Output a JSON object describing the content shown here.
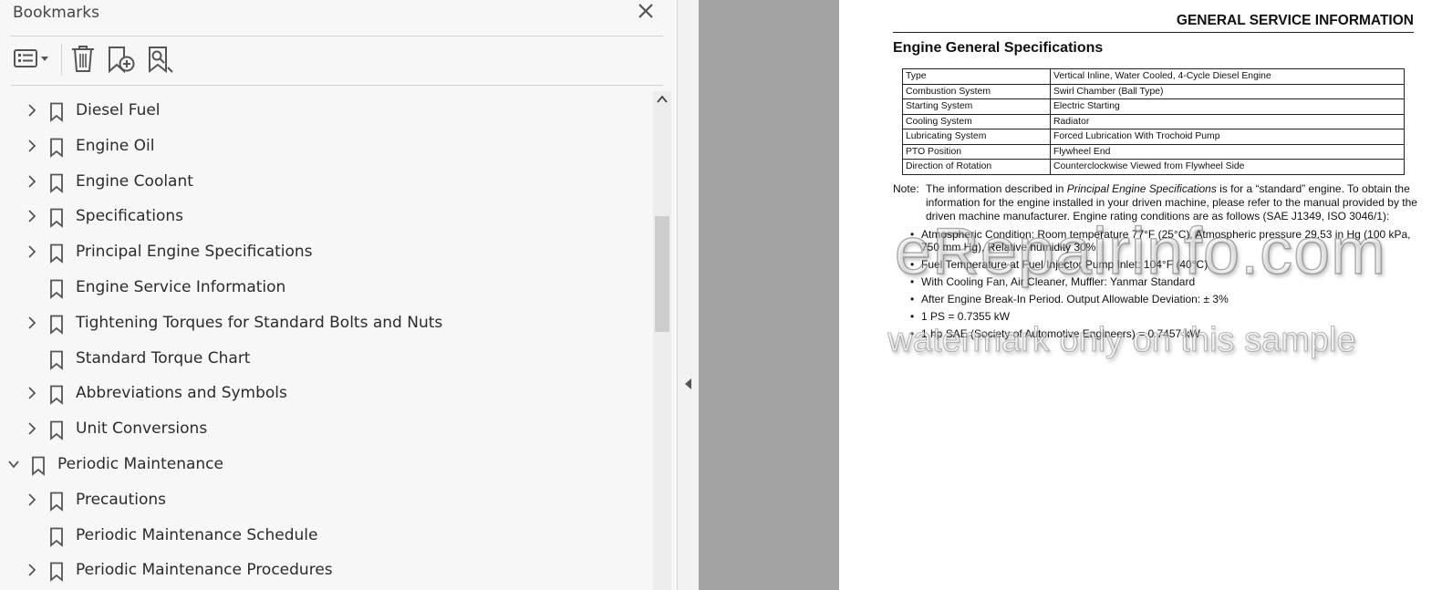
{
  "panel": {
    "title": "Bookmarks",
    "close_glyph": "✕",
    "toolbar": [
      {
        "name": "options-menu",
        "icon": "list-options-icon"
      },
      {
        "name": "delete-bookmark",
        "icon": "trash-icon"
      },
      {
        "name": "add-bookmark",
        "icon": "add-bookmark-icon"
      },
      {
        "name": "find-bookmark",
        "icon": "search-bookmark-icon"
      }
    ],
    "bookmarks": [
      {
        "label": "Diesel Fuel",
        "level": 1,
        "state": "collapsed"
      },
      {
        "label": "Engine Oil",
        "level": 1,
        "state": "collapsed"
      },
      {
        "label": "Engine Coolant",
        "level": 1,
        "state": "collapsed"
      },
      {
        "label": "Specifications",
        "level": 1,
        "state": "collapsed"
      },
      {
        "label": "Principal Engine Specifications",
        "level": 1,
        "state": "collapsed"
      },
      {
        "label": "Engine Service Information",
        "level": 1,
        "state": "leaf"
      },
      {
        "label": "Tightening Torques for Standard Bolts and Nuts",
        "level": 1,
        "state": "collapsed"
      },
      {
        "label": "Standard Torque Chart",
        "level": 1,
        "state": "leaf"
      },
      {
        "label": "Abbreviations and Symbols",
        "level": 1,
        "state": "collapsed"
      },
      {
        "label": "Unit Conversions",
        "level": 1,
        "state": "collapsed"
      },
      {
        "label": "Periodic Maintenance",
        "level": 0,
        "state": "expanded"
      },
      {
        "label": "Precautions",
        "level": 1,
        "state": "collapsed"
      },
      {
        "label": "Periodic Maintenance Schedule",
        "level": 1,
        "state": "leaf"
      },
      {
        "label": "Periodic Maintenance Procedures",
        "level": 1,
        "state": "collapsed"
      }
    ]
  },
  "page": {
    "header": "GENERAL SERVICE INFORMATION",
    "title": "Engine General Specifications",
    "spec_rows": [
      [
        "Type",
        "Vertical Inline, Water Cooled, 4-Cycle Diesel Engine"
      ],
      [
        "Combustion System",
        "Swirl Chamber (Ball Type)"
      ],
      [
        "Starting System",
        "Electric Starting"
      ],
      [
        "Cooling System",
        "Radiator"
      ],
      [
        "Lubricating System",
        "Forced Lubrication With Trochoid Pump"
      ],
      [
        "PTO Position",
        "Flywheel End"
      ],
      [
        "Direction of Rotation",
        "Counterclockwise Viewed from Flywheel Side"
      ]
    ],
    "note": {
      "prefix": "Note:",
      "text_before": "The information described in ",
      "italic": "Principal Engine Specifications",
      "text_after": "  is for a “standard” engine. To obtain the information for the engine installed in your driven machine, please refer to the manual provided by the driven machine manufacturer. Engine rating conditions are as follows (SAE J1349, ISO 3046/1):"
    },
    "bullets": [
      "Atmospheric Condition: Room temperature 77°F (25°C), Atmospheric pressure 29.53 in Hg (100 kPa, 750 mm Hg), Relative humidity 30%",
      "Fuel Temperature at Fuel Injector Pump Inlet: 104°F (40°C)",
      "With Cooling Fan, Air Cleaner, Muffler: Yanmar Standard",
      "After Engine Break-In Period. Output Allowable Deviation: ± 3%",
      "1 PS = 0.7355 kW",
      "1 hp SAE (Society of Automotive Engineers) = 0.7457 kW"
    ],
    "watermark_main": "eRepairinfo.com",
    "watermark_sub": "watermark only on this sample"
  }
}
